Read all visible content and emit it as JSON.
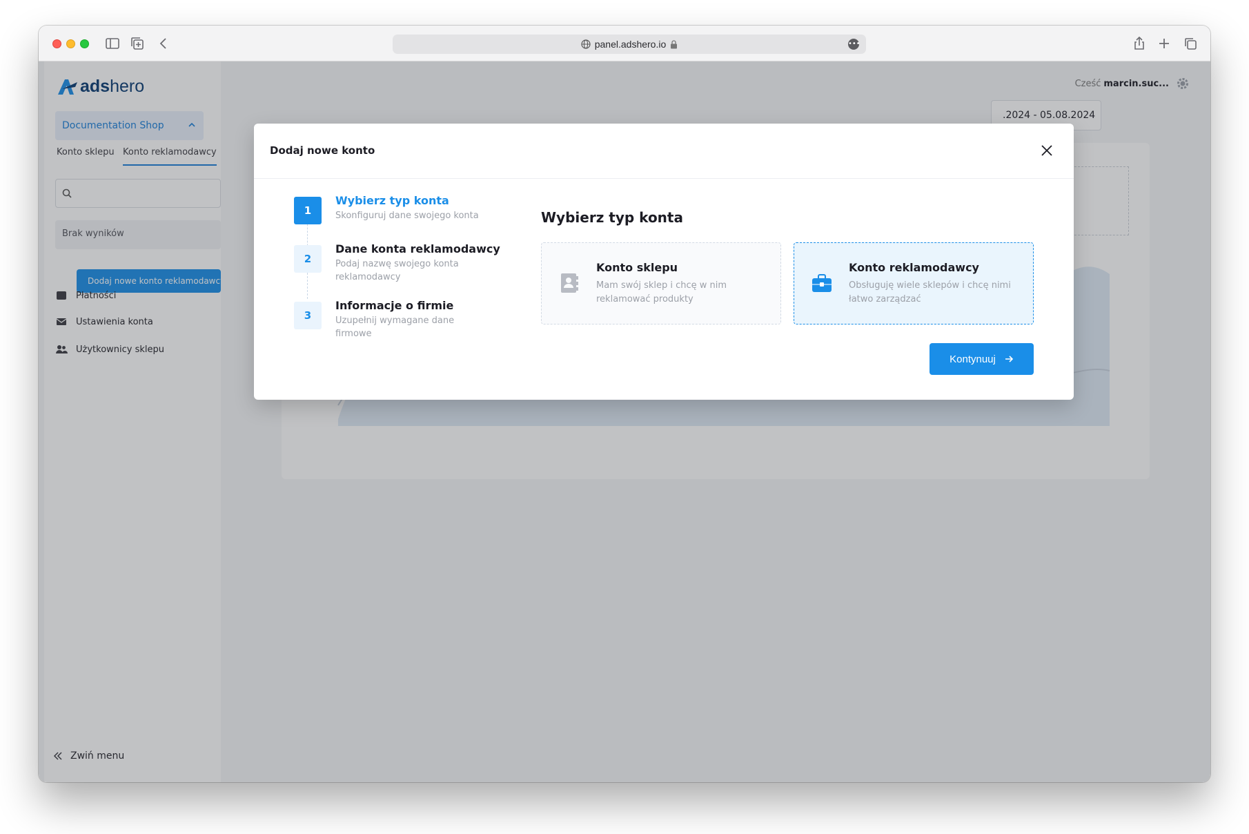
{
  "browser": {
    "url": "panel.adshero.io",
    "more_label": "•••"
  },
  "app": {
    "logo_text_bold": "ads",
    "logo_text": "hero",
    "greeting": "Cześć",
    "user_name": "marcin.suc...",
    "shop_name": "Documentation Shop",
    "tabs": [
      "Konto sklepu",
      "Konto reklamodawcy"
    ],
    "no_results": "Brak wyników",
    "add_account_button": "Dodaj nowe konto reklamodawcy",
    "menu": [
      {
        "label": "Płatności",
        "icon": "wallet-icon"
      },
      {
        "label": "Ustawienia konta",
        "icon": "envelope-icon"
      },
      {
        "label": "Użytkownicy sklepu",
        "icon": "users-icon"
      }
    ],
    "collapse_menu": "Zwiń menu",
    "date_range": ".2024 - 05.08.2024"
  },
  "modal": {
    "title": "Dodaj nowe konto",
    "steps": [
      {
        "number": "1",
        "title": "Wybierz typ konta",
        "subtitle": "Skonfiguruj dane swojego konta",
        "active": true
      },
      {
        "number": "2",
        "title": "Dane konta reklamodawcy",
        "subtitle": "Podaj nazwę swojego konta reklamodawcy",
        "active": false
      },
      {
        "number": "3",
        "title": "Informacje o firmie",
        "subtitle": "Uzupełnij wymagane dane firmowe",
        "active": false
      }
    ],
    "pane_title": "Wybierz typ konta",
    "options": [
      {
        "title": "Konto sklepu",
        "description": "Mam swój sklep i chcę w nim reklamować produkty",
        "icon": "contact-book-icon",
        "selected": false
      },
      {
        "title": "Konto reklamodawcy",
        "description": "Obsługuję wiele sklepów i chcę nimi łatwo zarządzać",
        "icon": "briefcase-icon",
        "selected": true
      }
    ],
    "continue_label": "Kontynuuj"
  },
  "colors": {
    "accent": "#1a8ee8",
    "selected_bg": "#eaf5fd",
    "overlay": "rgba(50,52,60,0.30)"
  }
}
